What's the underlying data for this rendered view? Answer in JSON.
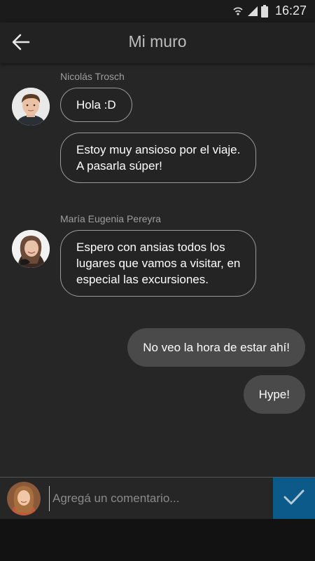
{
  "status_bar": {
    "time": "16:27"
  },
  "app_bar": {
    "title": "Mi muro",
    "back_icon": "arrow-left-icon"
  },
  "messages": [
    {
      "sender": "Nicolás Trosch",
      "lines": [
        "Hola :D",
        "Estoy muy ansioso por el viaje.\nA pasarla súper!"
      ]
    },
    {
      "sender": "María Eugenia Pereyra",
      "lines": [
        "Espero con ansias todos los\nlugares que vamos a visitar, en\nespecial las excursiones."
      ]
    }
  ],
  "own_messages": [
    "No veo la hora de estar ahí!",
    "Hype!"
  ],
  "composer": {
    "placeholder": "Agregá un comentario...",
    "send_icon": "checkmark-icon"
  },
  "colors": {
    "send_button": "#0b5a8a",
    "background": "#262626",
    "app_bar": "#222222",
    "outgoing_bubble": "#4a4a4a"
  }
}
